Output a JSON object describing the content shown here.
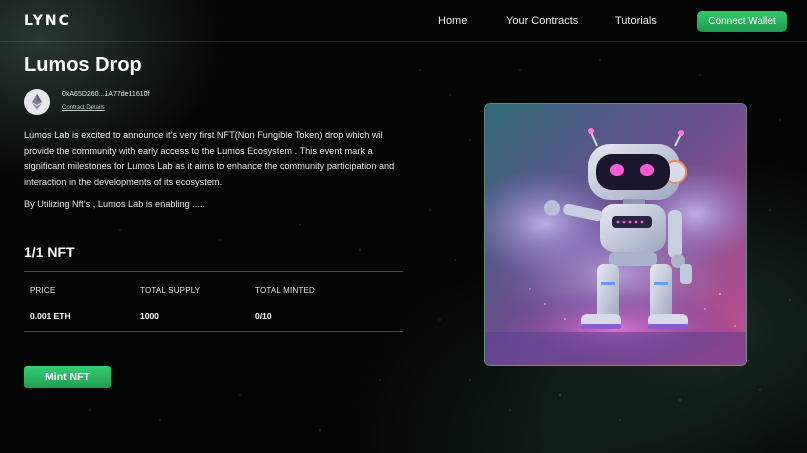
{
  "header": {
    "logo": "LYNC",
    "nav": [
      "Home",
      "Your Contracts",
      "Tutorials"
    ],
    "connect_label": "Connect Wallet"
  },
  "drop": {
    "title": "Lumos Drop",
    "address": "0xA65D260...1A77de11610f",
    "contract_link": "Contract Details",
    "avatar_icon": "ethereum-icon",
    "description": "Lumos Lab is excited to announce it’s very first NFT(Non Fungible Token) drop which wil provide the community with early access to the Lumos Ecosystem . This event mark a significant milestones for  Lumos Lab as it aims to enhance the community participation and interaction in the developments of its ecosystem.",
    "enabling": "By Utilizing Nft’s , Lumos Lab is enabling .....",
    "nft_count": "1/1 NFT",
    "stats": {
      "price_label": "PRICE",
      "price_value": "0.001 ETH",
      "supply_label": "TOTAL SUPPLY",
      "supply_value": "1000",
      "minted_label": "TOTAL MINTED",
      "minted_value": "0/10"
    },
    "mint_label": "Mint NFT",
    "artwork_icon": "robot-illustration"
  },
  "colors": {
    "accent": "#2cb85f",
    "background": "#050807"
  }
}
